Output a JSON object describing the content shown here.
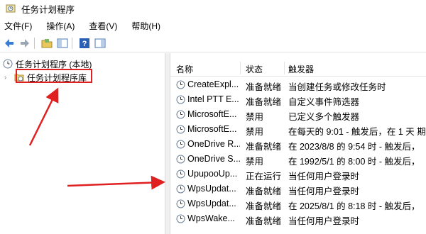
{
  "window": {
    "title": "任务计划程序"
  },
  "menu": [
    {
      "label": "文件(F)"
    },
    {
      "label": "操作(A)"
    },
    {
      "label": "查看(V)"
    },
    {
      "label": "帮助(H)"
    }
  ],
  "toolbar": {
    "icons": [
      "back-icon",
      "forward-icon",
      "folder-icon",
      "panel-icon",
      "help-icon",
      "panel2-icon"
    ]
  },
  "tree": {
    "root": "任务计划程序 (本地)",
    "library": "任务计划程序库"
  },
  "table": {
    "columns": [
      "名称",
      "状态",
      "触发器"
    ],
    "rows": [
      {
        "name": "CreateExpl...",
        "status": "准备就绪",
        "trigger": "当创建任务或修改任务时"
      },
      {
        "name": "Intel PTT E...",
        "status": "准备就绪",
        "trigger": "自定义事件筛选器"
      },
      {
        "name": "MicrosoftE...",
        "status": "禁用",
        "trigger": "已定义多个触发器"
      },
      {
        "name": "MicrosoftE...",
        "status": "禁用",
        "trigger": "在每天的 9:01 - 触发后，在 1 天 期"
      },
      {
        "name": "OneDrive R...",
        "status": "准备就绪",
        "trigger": "在 2023/8/8 的 9:54 时 - 触发后，"
      },
      {
        "name": "OneDrive S...",
        "status": "禁用",
        "trigger": "在 1992/5/1 的 8:00 时 - 触发后，"
      },
      {
        "name": "UpupooUp...",
        "status": "正在运行",
        "trigger": "当任何用户登录时"
      },
      {
        "name": "WpsUpdat...",
        "status": "准备就绪",
        "trigger": "当任何用户登录时"
      },
      {
        "name": "WpsUpdat...",
        "status": "准备就绪",
        "trigger": "在 2025/8/1 的 8:18 时 - 触发后，"
      },
      {
        "name": "WpsWake...",
        "status": "准备就绪",
        "trigger": "当任何用户登录时"
      }
    ]
  },
  "colors": {
    "accent": "#e02020",
    "icon_blue": "#2f6fd0"
  }
}
